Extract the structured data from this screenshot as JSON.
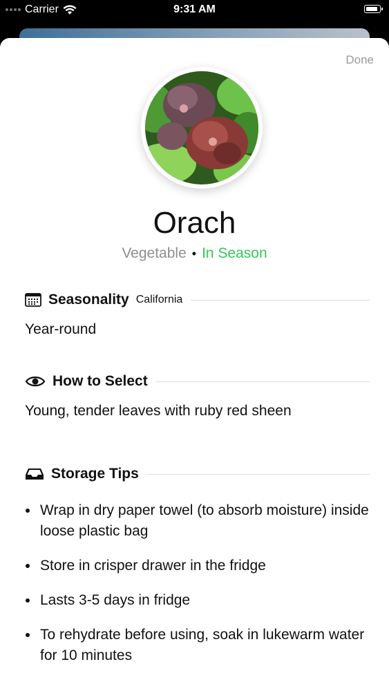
{
  "status_bar": {
    "carrier": "Carrier",
    "time": "9:31 AM"
  },
  "sheet": {
    "done_label": "Done",
    "title": "Orach",
    "category": "Vegetable",
    "season_status": "In Season",
    "season_color": "#34c759"
  },
  "seasonality": {
    "title": "Seasonality",
    "region": "California",
    "body": "Year-round",
    "icon": "calendar-icon"
  },
  "how_to_select": {
    "title": "How to Select",
    "body": "Young, tender leaves with ruby red sheen",
    "icon": "eye-icon"
  },
  "storage_tips": {
    "title": "Storage Tips",
    "icon": "tray-icon",
    "items": [
      "Wrap in dry paper towel (to absorb moisture) inside loose plastic bag",
      "Store in crisper drawer in the fridge",
      "Lasts 3-5 days in fridge",
      "To rehydrate before using, soak in lukewarm water for 10 minutes"
    ]
  }
}
